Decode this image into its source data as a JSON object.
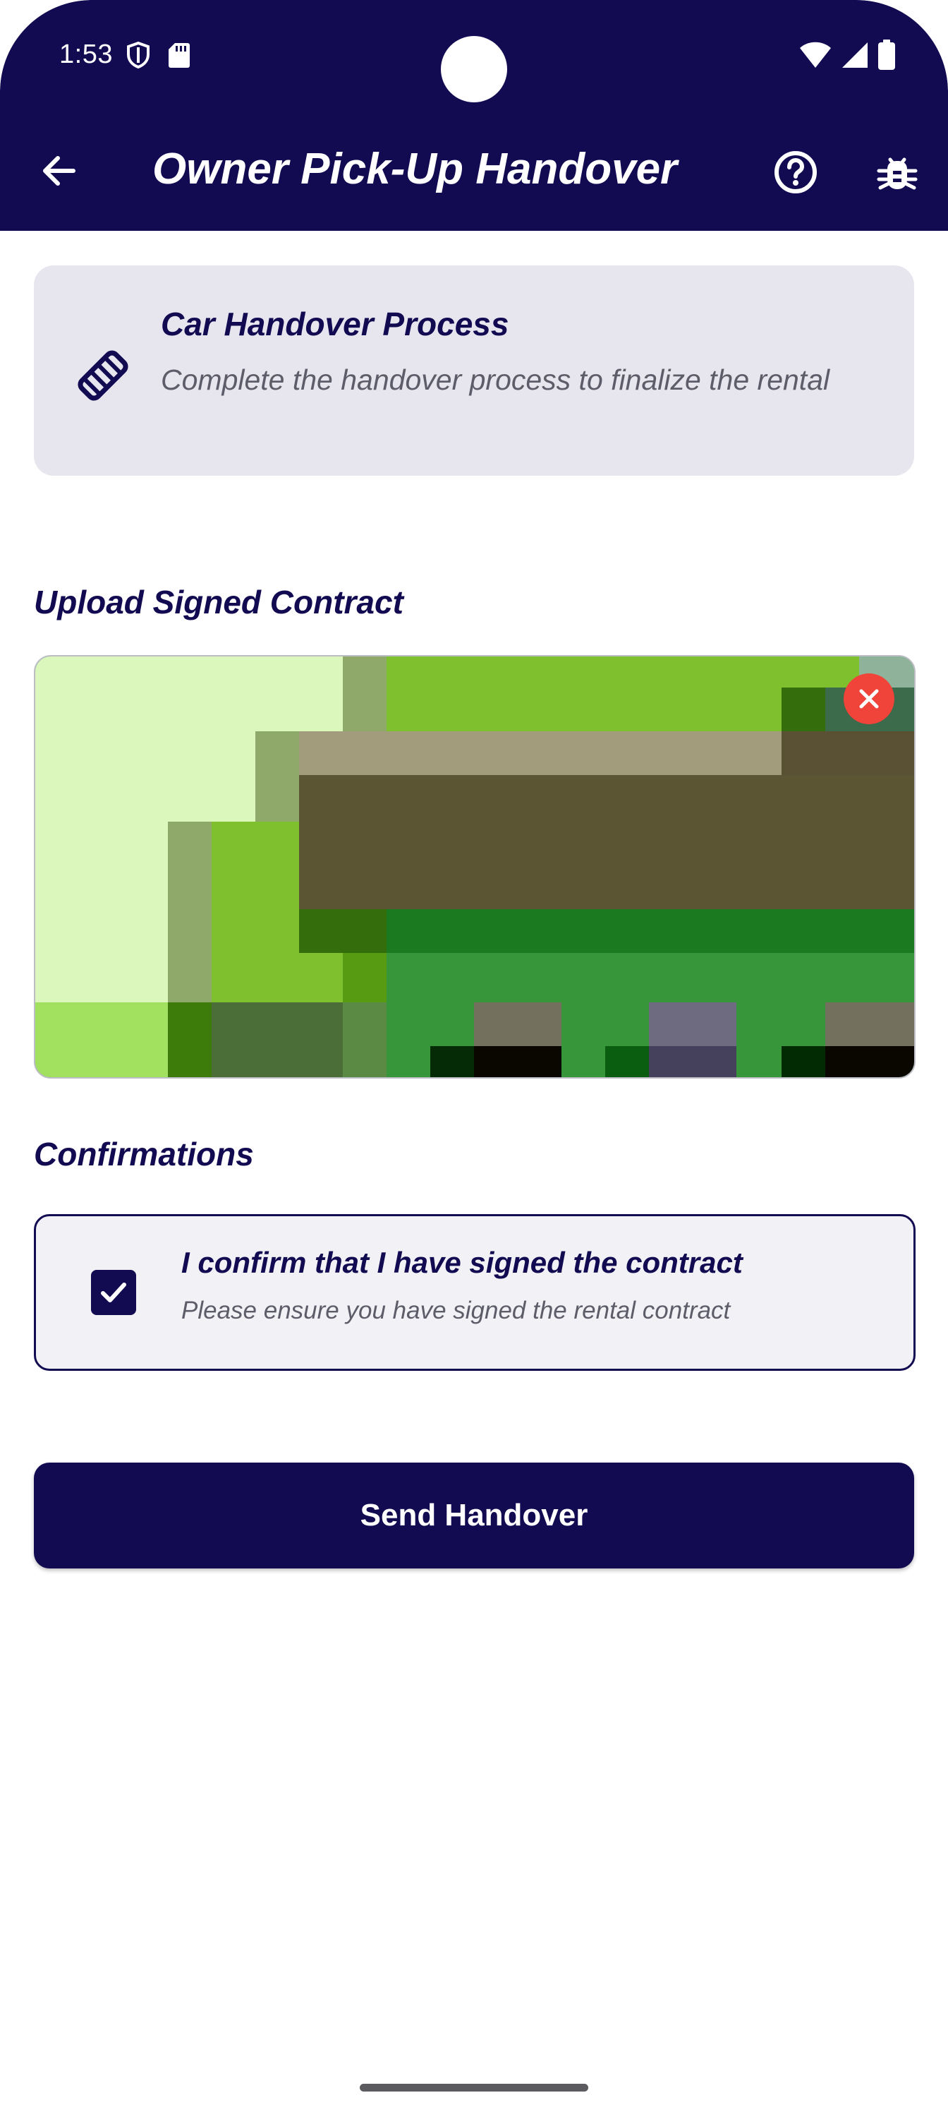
{
  "status_bar": {
    "time": "1:53",
    "left_icons": [
      "shield-icon",
      "sd-card-icon"
    ],
    "right_icons": [
      "wifi-icon",
      "signal-icon",
      "battery-icon"
    ]
  },
  "app_bar": {
    "title": "Owner Pick-Up Handover",
    "back_icon": "arrow-back-icon",
    "help_icon": "help-circle-icon",
    "debug_icon": "bug-icon"
  },
  "info_card": {
    "icon": "handshake-icon",
    "title": "Car Handover Process",
    "description": "Complete the handover process to finalize the rental"
  },
  "upload_section": {
    "label": "Upload Signed Contract",
    "remove_icon": "close-icon"
  },
  "confirmations": {
    "label": "Confirmations",
    "items": [
      {
        "checked": true,
        "title": "I confirm that I have signed the contract",
        "subtitle": "Please ensure you have signed the rental contract"
      }
    ]
  },
  "actions": {
    "send_label": "Send Handover"
  },
  "colors": {
    "primary": "#120b52",
    "card_bg": "#e7e6ee",
    "remove": "#f0433a",
    "muted_text": "#5d5d6a"
  }
}
